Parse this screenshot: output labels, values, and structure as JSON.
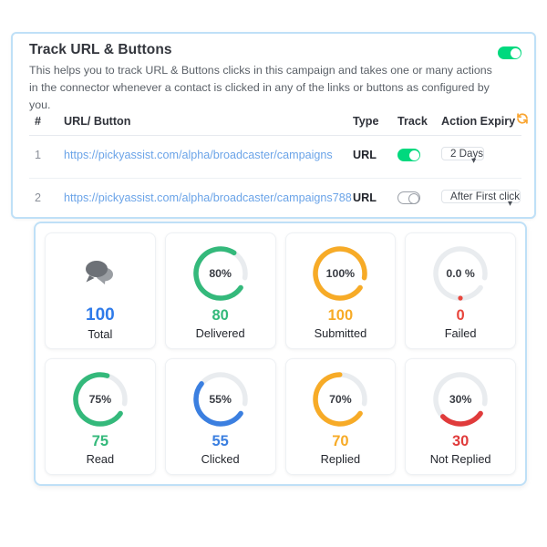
{
  "track_card": {
    "title": "Track URL & Buttons",
    "description": "This helps you to track URL & Buttons clicks in this campaign and takes one or many actions in the connector whenever a contact is clicked in any of the links or buttons as configured by you.",
    "master_toggle": {
      "name": "track-url-master-toggle",
      "state": "on",
      "color": "#00d97e"
    }
  },
  "table": {
    "headers": {
      "num": "#",
      "url": "URL/ Button",
      "type": "Type",
      "track": "Track",
      "expiry": "Action Expiry"
    },
    "refresh_icon": "refresh-icon",
    "refresh_color": "#f9a633",
    "rows": [
      {
        "num": "1",
        "url": "https://pickyassist.com/alpha/broadcaster/campaigns",
        "type": "URL",
        "track_state": "on",
        "expiry": "2 Days"
      },
      {
        "num": "2",
        "url": "https://pickyassist.com/alpha/broadcaster/campaigns788",
        "type": "URL",
        "track_state": "off",
        "expiry": "After First click"
      }
    ]
  },
  "stats": {
    "cards": [
      {
        "label": "Total",
        "value": "100",
        "percent_text": "",
        "percent": 0,
        "color": "#2f7bea",
        "icon": "chat-bubbles-icon",
        "type": "icon"
      },
      {
        "label": "Delivered",
        "value": "80",
        "percent_text": "80%",
        "percent": 80,
        "color": "#34b97b",
        "type": "ring"
      },
      {
        "label": "Submitted",
        "value": "100",
        "percent_text": "100%",
        "percent": 100,
        "color": "#f7ab27",
        "type": "ring"
      },
      {
        "label": "Failed",
        "value": "0",
        "percent_text": "0.0 %",
        "percent": 0,
        "color": "#e8453c",
        "type": "ring"
      },
      {
        "label": "Read",
        "value": "75",
        "percent_text": "75%",
        "percent": 75,
        "color": "#34b97b",
        "type": "ring"
      },
      {
        "label": "Clicked",
        "value": "55",
        "percent_text": "55%",
        "percent": 55,
        "color": "#3b7fe0",
        "type": "ring"
      },
      {
        "label": "Replied",
        "value": "70",
        "percent_text": "70%",
        "percent": 70,
        "color": "#f7ab27",
        "type": "ring"
      },
      {
        "label": "Not Replied",
        "value": "30",
        "percent_text": "30%",
        "percent": 30,
        "color": "#e03b3b",
        "type": "ring"
      }
    ],
    "track_color": "#e9ecef"
  }
}
